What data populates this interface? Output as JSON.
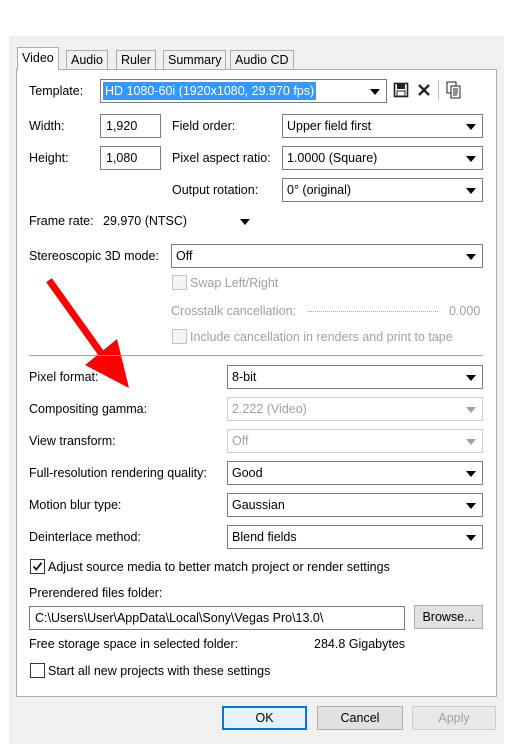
{
  "tabs": [
    "Video",
    "Audio",
    "Ruler",
    "Summary",
    "Audio CD"
  ],
  "template": {
    "label": "Template:",
    "value": "HD 1080-60i (1920x1080, 29.970 fps)"
  },
  "width": {
    "label": "Width:",
    "value": "1,920"
  },
  "height": {
    "label": "Height:",
    "value": "1,080"
  },
  "field_order": {
    "label": "Field order:",
    "value": "Upper field first"
  },
  "pixel_aspect": {
    "label": "Pixel aspect ratio:",
    "value": "1.0000 (Square)"
  },
  "output_rotation": {
    "label": "Output rotation:",
    "value": "0° (original)"
  },
  "frame_rate": {
    "label": "Frame rate:",
    "value": "29.970 (NTSC)"
  },
  "stereo": {
    "label": "Stereoscopic 3D mode:",
    "value": "Off"
  },
  "swap": {
    "label": "Swap Left/Right",
    "checked": false
  },
  "crosstalk": {
    "label": "Crosstalk cancellation:",
    "value": "0.000"
  },
  "include_cancel": {
    "label": "Include cancellation in renders and print to tape",
    "checked": false
  },
  "pixel_format": {
    "label": "Pixel format:",
    "value": "8-bit"
  },
  "compositing_gamma": {
    "label": "Compositing gamma:",
    "value": "2.222 (Video)"
  },
  "view_transform": {
    "label": "View transform:",
    "value": "Off"
  },
  "full_res": {
    "label": "Full-resolution rendering quality:",
    "value": "Good"
  },
  "motion_blur": {
    "label": "Motion blur type:",
    "value": "Gaussian"
  },
  "deinterlace": {
    "label": "Deinterlace method:",
    "value": "Blend fields"
  },
  "adjust_source": {
    "label": "Adjust source media to better match project or render settings",
    "checked": true
  },
  "prerendered": {
    "label": "Prerendered files folder:",
    "value": "C:\\Users\\User\\AppData\\Local\\Sony\\Vegas Pro\\13.0\\",
    "browse": "Browse..."
  },
  "free_storage": {
    "label": "Free storage space in selected folder:",
    "value": "284.8 Gigabytes"
  },
  "start_all": {
    "label": "Start all new projects with these settings",
    "checked": false
  },
  "buttons": {
    "ok": "OK",
    "cancel": "Cancel",
    "apply": "Apply"
  },
  "colors": {
    "arrow": "#ff0000",
    "selection": "#3399ff",
    "default_button": "#0078d7"
  },
  "icons": [
    "save-icon",
    "delete-icon",
    "copy-icon",
    "red-arrow-annotation"
  ]
}
